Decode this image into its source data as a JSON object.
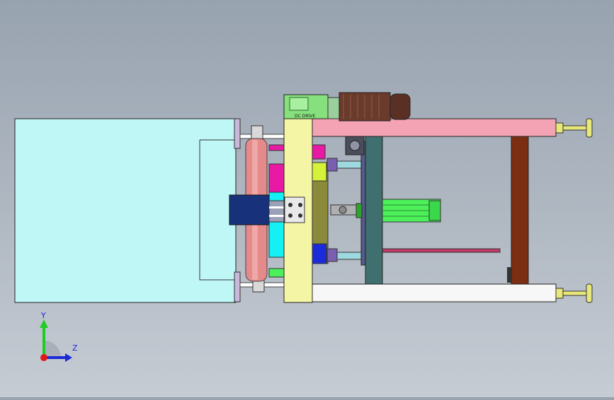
{
  "model_view": {
    "motor_label": "DC DRIVE",
    "colors": {
      "background_top": "#98a3b0",
      "background_bottom": "#c6ccd4",
      "left_block": "#bff7f7",
      "yellow_plate": "#f5f5a6",
      "pink_frame": "#f4a3b4",
      "brown_post": "#7b2e12",
      "green_gearbox": "#86e07d",
      "motor_body": "#6a3a2b",
      "green_cylinder": "#4cf05a",
      "magenta_block": "#e81aa5",
      "cyan_block": "#15f0f5",
      "navy_block": "#17327a",
      "roller": "#e58a8a",
      "olive_plate": "#8a8a3a",
      "teal_column": "#3f6f6f",
      "foot": "#e8e87a"
    }
  },
  "triad": {
    "y_label": "Y",
    "z_label": "Z",
    "y_color": "#1fcc26",
    "z_color": "#1a2bd6",
    "x_color": "#e01919"
  }
}
